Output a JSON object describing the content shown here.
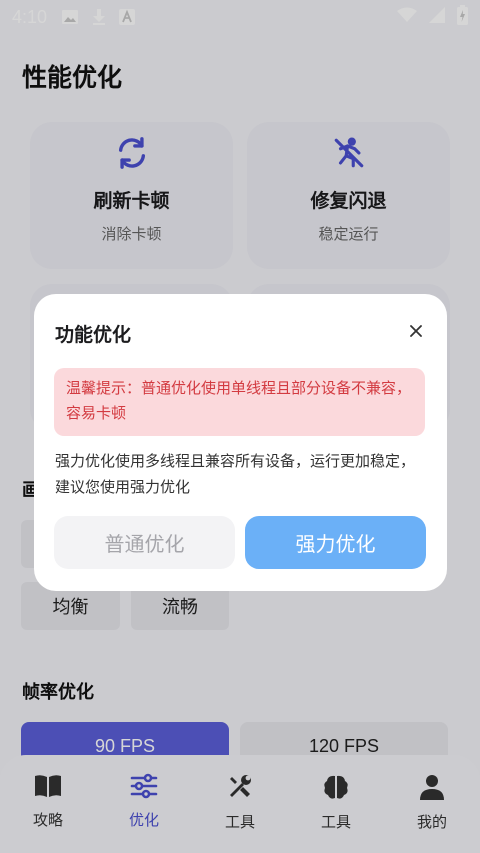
{
  "status_bar": {
    "time": "4:10"
  },
  "page": {
    "title": "性能优化"
  },
  "cards": [
    {
      "title": "刷新卡顿",
      "subtitle": "消除卡顿",
      "icon": "refresh-icon"
    },
    {
      "title": "修复闪退",
      "subtitle": "稳定运行",
      "icon": "crash-fix-icon"
    }
  ],
  "sections": {
    "quality_title_partial": "画",
    "fps_title": "帧率优化"
  },
  "quality_options": [
    "均衡",
    "流畅"
  ],
  "fps_options": [
    {
      "label": "90 FPS",
      "active": true
    },
    {
      "label": "120 FPS",
      "active": false
    }
  ],
  "bottom_nav": [
    {
      "label": "攻略",
      "icon": "book-icon",
      "active": false
    },
    {
      "label": "优化",
      "icon": "sliders-icon",
      "active": true
    },
    {
      "label": "工具",
      "icon": "tools-icon",
      "active": false
    },
    {
      "label": "工具",
      "icon": "brain-icon",
      "active": false
    },
    {
      "label": "我的",
      "icon": "person-icon",
      "active": false
    }
  ],
  "dialog": {
    "title": "功能优化",
    "warning": "温馨提示：普通优化使用单线程且部分设备不兼容，容易卡顿",
    "description": "强力优化使用多线程且兼容所有设备，运行更加稳定，建议您使用强力优化",
    "normal_button": "普通优化",
    "strong_button": "强力优化"
  },
  "colors": {
    "accent": "#5b5fd8",
    "nav_active": "#4a4fd0",
    "primary_button": "#6bb0f7",
    "warning_bg": "#fbd9dc",
    "warning_text": "#d33b41"
  }
}
